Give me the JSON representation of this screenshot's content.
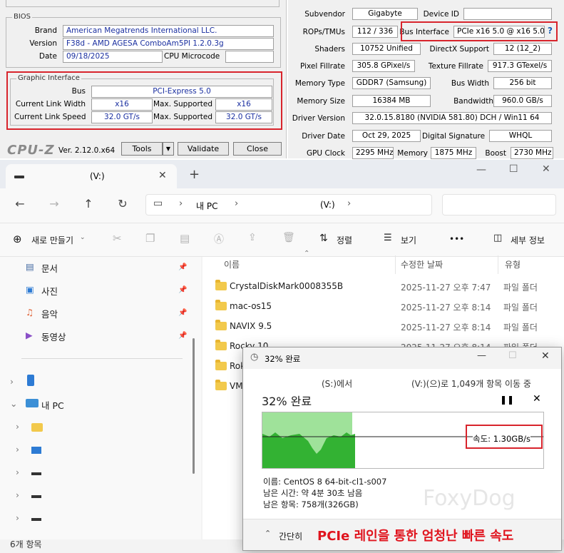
{
  "cpuz": {
    "bios": {
      "legend": "BIOS",
      "brand_label": "Brand",
      "brand": "American Megatrends International LLC.",
      "version_label": "Version",
      "version": "F38d - AMD AGESA ComboAm5PI 1.2.0.3g",
      "date_label": "Date",
      "date": "09/18/2025",
      "microcode_label": "CPU Microcode",
      "microcode": ""
    },
    "graphic": {
      "legend": "Graphic Interface",
      "bus_label": "Bus",
      "bus": "PCI-Express 5.0",
      "link_width_label": "Current Link Width",
      "link_width": "x16",
      "max_width_label": "Max. Supported",
      "max_width": "x16",
      "link_speed_label": "Current Link Speed",
      "link_speed": "32.0 GT/s",
      "max_speed_label": "Max. Supported",
      "max_speed": "32.0 GT/s"
    },
    "footer": {
      "logo": "CPU-Z",
      "version": "Ver. 2.12.0.x64",
      "tools": "Tools",
      "validate": "Validate",
      "close": "Close"
    }
  },
  "gpuz": {
    "subvendor_label": "Subvendor",
    "subvendor": "Gigabyte",
    "device_id_label": "Device ID",
    "device_id": "",
    "rops_label": "ROPs/TMUs",
    "rops": "112 / 336",
    "bus_if_label": "Bus Interface",
    "bus_if": "PCIe x16 5.0 @ x16 5.0",
    "help": "?",
    "shaders_label": "Shaders",
    "shaders": "10752 Unified",
    "dx_label": "DirectX Support",
    "dx": "12 (12_2)",
    "pixel_label": "Pixel Fillrate",
    "pixel": "305.8 GPixel/s",
    "texture_label": "Texture Fillrate",
    "texture": "917.3 GTexel/s",
    "memtype_label": "Memory Type",
    "memtype": "GDDR7 (Samsung)",
    "buswidth_label": "Bus Width",
    "buswidth": "256 bit",
    "memsize_label": "Memory Size",
    "memsize": "16384 MB",
    "bandwidth_label": "Bandwidth",
    "bandwidth": "960.0 GB/s",
    "driver_label": "Driver Version",
    "driver": "32.0.15.8180 (NVIDIA 581.80) DCH / Win11 64",
    "driverdate_label": "Driver Date",
    "driverdate": "Oct 29, 2025",
    "sig_label": "Digital Signature",
    "sig": "WHQL",
    "gpuclock_label": "GPU Clock",
    "gpuclock": "2295 MHz",
    "memclock_label": "Memory",
    "memclock": "1875 MHz",
    "boost_label": "Boost",
    "boost": "2730 MHz"
  },
  "explorer": {
    "tab_title": "(V:)",
    "new_tab": "+",
    "breadcrumb": [
      "내 PC",
      "(V:)"
    ],
    "toolbar": {
      "new": "새로 만들기",
      "sort": "정렬",
      "view": "보기",
      "more": "•••",
      "details": "세부 정보"
    },
    "sidebar": [
      {
        "label": "문서",
        "icon": "documents-icon"
      },
      {
        "label": "사진",
        "icon": "pictures-icon"
      },
      {
        "label": "음악",
        "icon": "music-icon"
      },
      {
        "label": "동영상",
        "icon": "videos-icon"
      }
    ],
    "this_pc": "내 PC",
    "columns": {
      "name": "이름",
      "date": "수정한 날짜",
      "type": "유형"
    },
    "files": [
      {
        "name": "CrystalDiskMark0008355B",
        "date": "2025-11-27 오후 7:47",
        "type": "파일 폴더"
      },
      {
        "name": "mac-os15",
        "date": "2025-11-27 오후 8:14",
        "type": "파일 폴더"
      },
      {
        "name": "NAVIX 9.5",
        "date": "2025-11-27 오후 8:14",
        "type": "파일 폴더"
      },
      {
        "name": "Rocky 10",
        "date": "2025-11-27 오후 8:14",
        "type": "파일 폴더"
      },
      {
        "name": "Rok",
        "date": "",
        "type": ""
      },
      {
        "name": "VM",
        "date": "",
        "type": ""
      }
    ],
    "status": "6개 항목"
  },
  "copy": {
    "title": "32% 완료",
    "source": "(S:)에서",
    "dest": "(V:)(으)로 1,049개 항목 이동 중",
    "percent_label": "32% 완료",
    "progress": 0.32,
    "speed": "속도: 1.30GB/s",
    "name": "이름: CentOS 8 64-bit-cl1-s007",
    "remaining_time": "남은 시간: 약 4분 30초 남음",
    "remaining_items": "남은 항목: 758개(326GB)",
    "collapse": "간단히",
    "caption": "PCIe 레인을 통한 엄청난 빠른 속도",
    "watermark": "FoxyDog"
  },
  "colors": {
    "red": "#d8242c",
    "value_blue": "#1a2fa0",
    "chart_green": "#4cbb4c"
  }
}
